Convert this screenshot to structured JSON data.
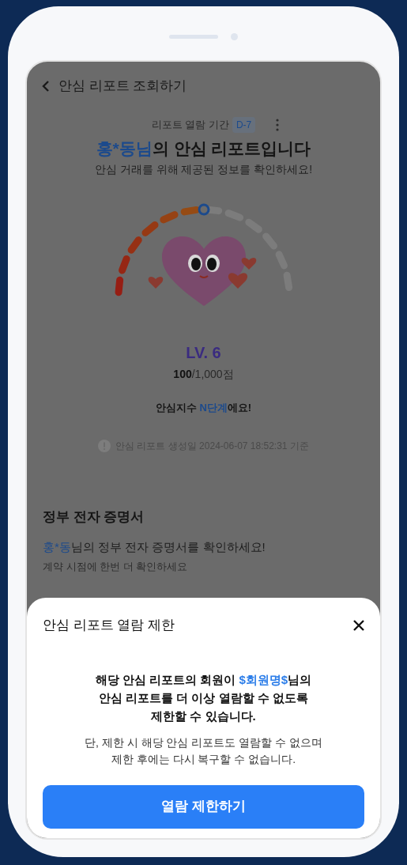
{
  "header": {
    "title": "안심 리포트 조회하기"
  },
  "report": {
    "period_label": "리포트 열람 기간",
    "period_badge": "D-7",
    "title_name": "홍*동님",
    "title_rest": "의 안심 리포트입니다",
    "subtitle": "안심 거래를 위해 제공된 정보를 확인하세요!",
    "gauge": {
      "level": 0.5
    },
    "level_label": "LV. 6",
    "score": "100",
    "score_total": "/1,000점",
    "index_prefix": "안심지수 ",
    "index_value": "N단계",
    "index_suffix": "에요!",
    "generated": "안심 리포트 생성일 2024-06-07 18:52:31 기준"
  },
  "certificate": {
    "heading": "정부 전자 증명서",
    "name": "홍*동",
    "message": "님의 정부 전자 증명서를 확인하세요!",
    "note": "계약 시점에 한번 더 확인하세요"
  },
  "sheet": {
    "title": "안심 리포트 열람 제한",
    "warning": [
      {
        "text": "해당 안심 리포트의 회원이 ",
        "highlight": false
      },
      {
        "text": "$회원명$",
        "highlight": true
      },
      {
        "text": "님의\n안심 리포트를 더 이상 열람할 수 없도록\n제한할 수 있습니다.",
        "highlight": false
      }
    ],
    "note": "단, 제한 시 해당 안심 리포트도 열람할 수 없으며\n제한 후에는 다시 복구할 수 없습니다.",
    "button": "열람 제한하기"
  }
}
